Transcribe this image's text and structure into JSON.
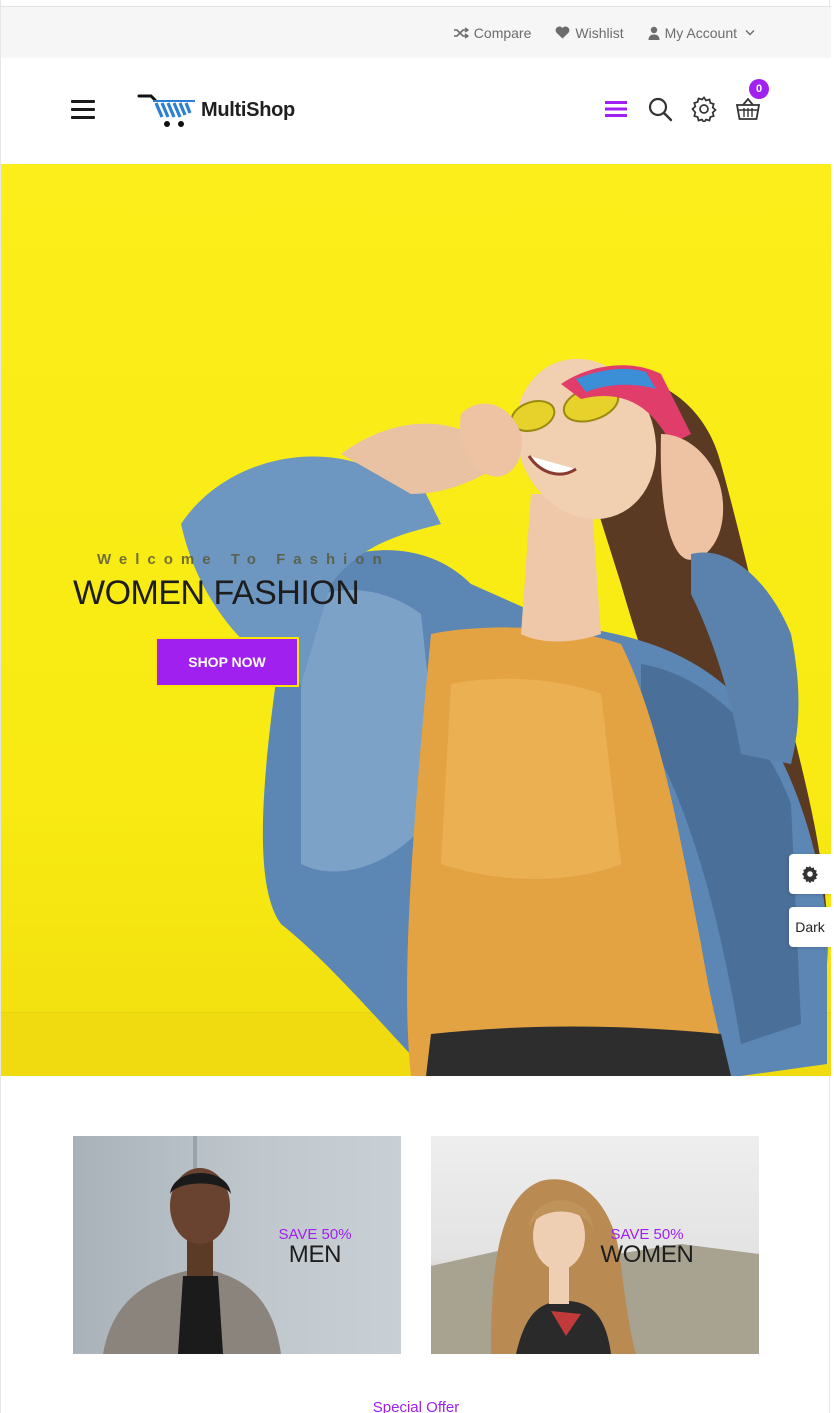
{
  "topbar": {
    "compare_label": "Compare",
    "wishlist_label": "Wishlist",
    "account_label": "My Account"
  },
  "header": {
    "logo_text": "MultiShop",
    "cart_count": "0",
    "accent_color": "#a020f0"
  },
  "hero": {
    "subtitle": "Welcome To Fashion",
    "title": "WOMEN FASHION",
    "button_label": "SHOP NOW",
    "background_color": "#fbee1a"
  },
  "side_panel": {
    "dark_label": "Dark"
  },
  "banners": [
    {
      "offer": "SAVE 50%",
      "category": "MEN"
    },
    {
      "offer": "SAVE 50%",
      "category": "WOMEN"
    }
  ],
  "section": {
    "special_offer": "Special Offer"
  },
  "icons": [
    "shuffle-icon",
    "heart-icon",
    "user-icon",
    "chevron-down-icon",
    "menu-icon",
    "logo-cart-icon",
    "list-menu-icon",
    "search-icon",
    "gear-icon",
    "basket-icon"
  ]
}
